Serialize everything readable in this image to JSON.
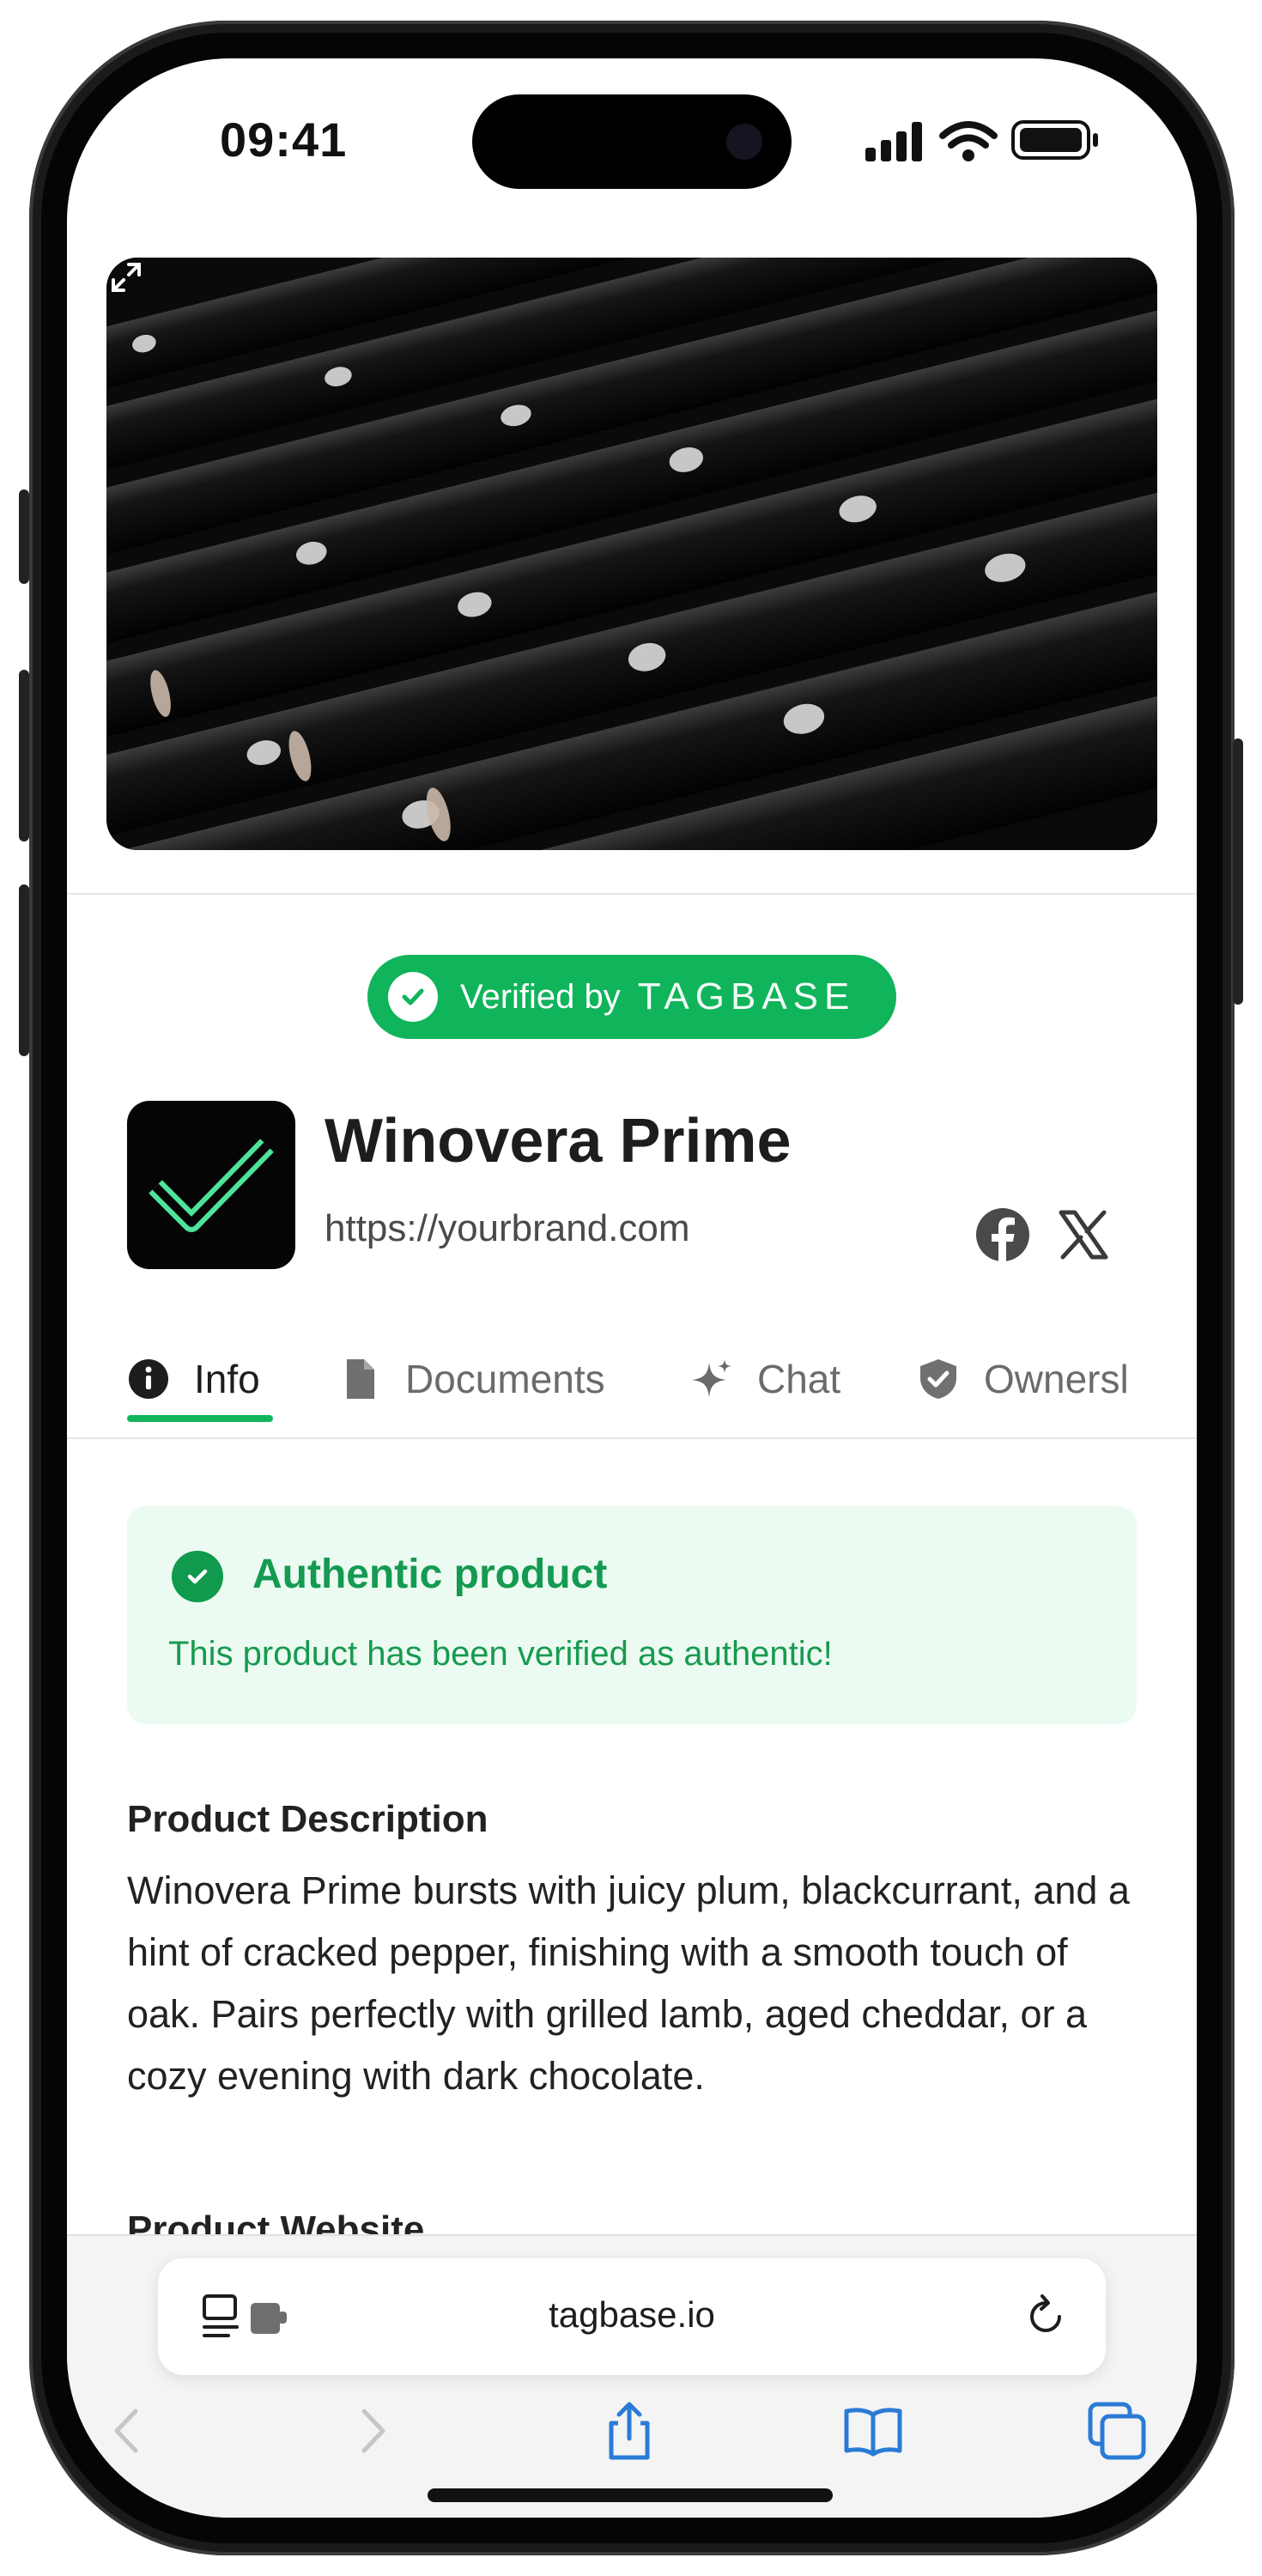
{
  "status_bar": {
    "time": "09:41"
  },
  "hero": {
    "alt_icon": "expand-icon"
  },
  "verified_badge": {
    "label": "Verified by",
    "brand": "TAGBASE",
    "color": "#10b45b"
  },
  "brand": {
    "name": "Winovera Prime",
    "url": "https://yourbrand.com",
    "social": [
      "facebook-icon",
      "x-icon"
    ]
  },
  "tabs": [
    {
      "label": "Info",
      "icon": "info-icon",
      "active": true
    },
    {
      "label": "Documents",
      "icon": "document-icon",
      "active": false
    },
    {
      "label": "Chat",
      "icon": "sparkle-icon",
      "active": false
    },
    {
      "label": "Ownersl",
      "icon": "shield-icon",
      "active": false
    }
  ],
  "authentic": {
    "title": "Authentic product",
    "message": "This product has been verified as authentic!"
  },
  "description": {
    "heading": "Product Description",
    "body": "Winovera Prime bursts with juicy plum, blackcurrant, and a hint of cracked pepper, finishing with a smooth touch of oak. Pairs perfectly with grilled lamb, aged cheddar, or a cozy evening with dark chocolate."
  },
  "next_section": {
    "heading": "Product Website"
  },
  "browser": {
    "url": "tagbase.io",
    "accent": "#2a7bd6"
  }
}
